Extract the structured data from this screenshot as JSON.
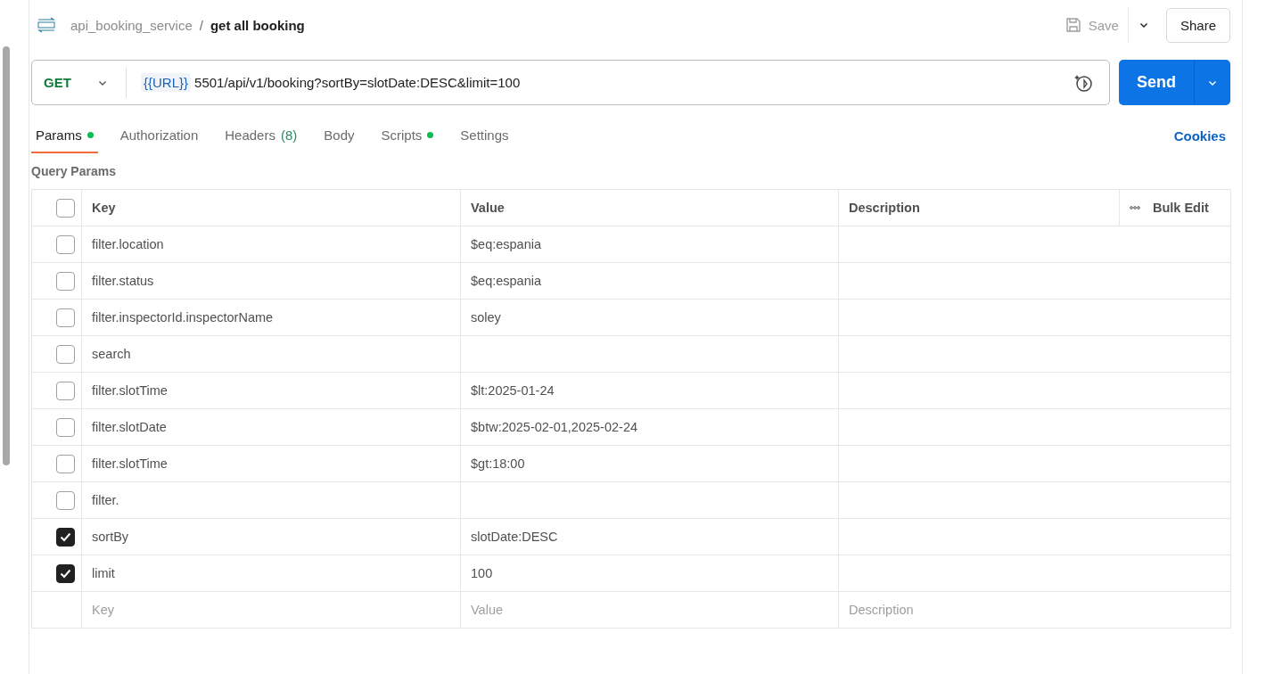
{
  "breadcrumb": {
    "collection": "api_booking_service",
    "separator": "/",
    "request": "get all booking"
  },
  "actions": {
    "save": "Save",
    "share": "Share"
  },
  "request": {
    "method": "GET",
    "variable": "{{URL}}",
    "url": "5501/api/v1/booking?sortBy=slotDate:DESC&limit=100",
    "send": "Send"
  },
  "tabs": [
    {
      "label": "Params",
      "dot": true,
      "selected": true
    },
    {
      "label": "Authorization",
      "dot": false,
      "selected": false
    },
    {
      "label": "Headers",
      "count": "(8)",
      "dot": false,
      "selected": false
    },
    {
      "label": "Body",
      "dot": false,
      "selected": false
    },
    {
      "label": "Scripts",
      "dot": true,
      "selected": false
    },
    {
      "label": "Settings",
      "dot": false,
      "selected": false
    }
  ],
  "cookies": "Cookies",
  "section_title": "Query Params",
  "table": {
    "columns": [
      "Key",
      "Value",
      "Description"
    ],
    "bulk_edit": "Bulk Edit",
    "header_checked": false,
    "rows": [
      {
        "checked": false,
        "key": "filter.location",
        "value": "$eq:espania"
      },
      {
        "checked": false,
        "key": "filter.status",
        "value": "$eq:espania"
      },
      {
        "checked": false,
        "key": "filter.inspectorId.inspectorName",
        "value": "soley"
      },
      {
        "checked": false,
        "key": "search"
      },
      {
        "checked": false,
        "key": "filter.slotTime",
        "value": "$lt:2025-01-24"
      },
      {
        "checked": false,
        "key": "filter.slotDate",
        "value": "$btw:2025-02-01,2025-02-24"
      },
      {
        "checked": false,
        "key": "filter.slotTime",
        "value": "$gt:18:00"
      },
      {
        "checked": false,
        "key": "filter."
      },
      {
        "checked": true,
        "key": "sortBy",
        "value": "slotDate:DESC"
      },
      {
        "checked": true,
        "key": "limit",
        "value": "100"
      }
    ],
    "placeholders": {
      "key": "Key",
      "value": "Value",
      "description": "Description"
    }
  }
}
